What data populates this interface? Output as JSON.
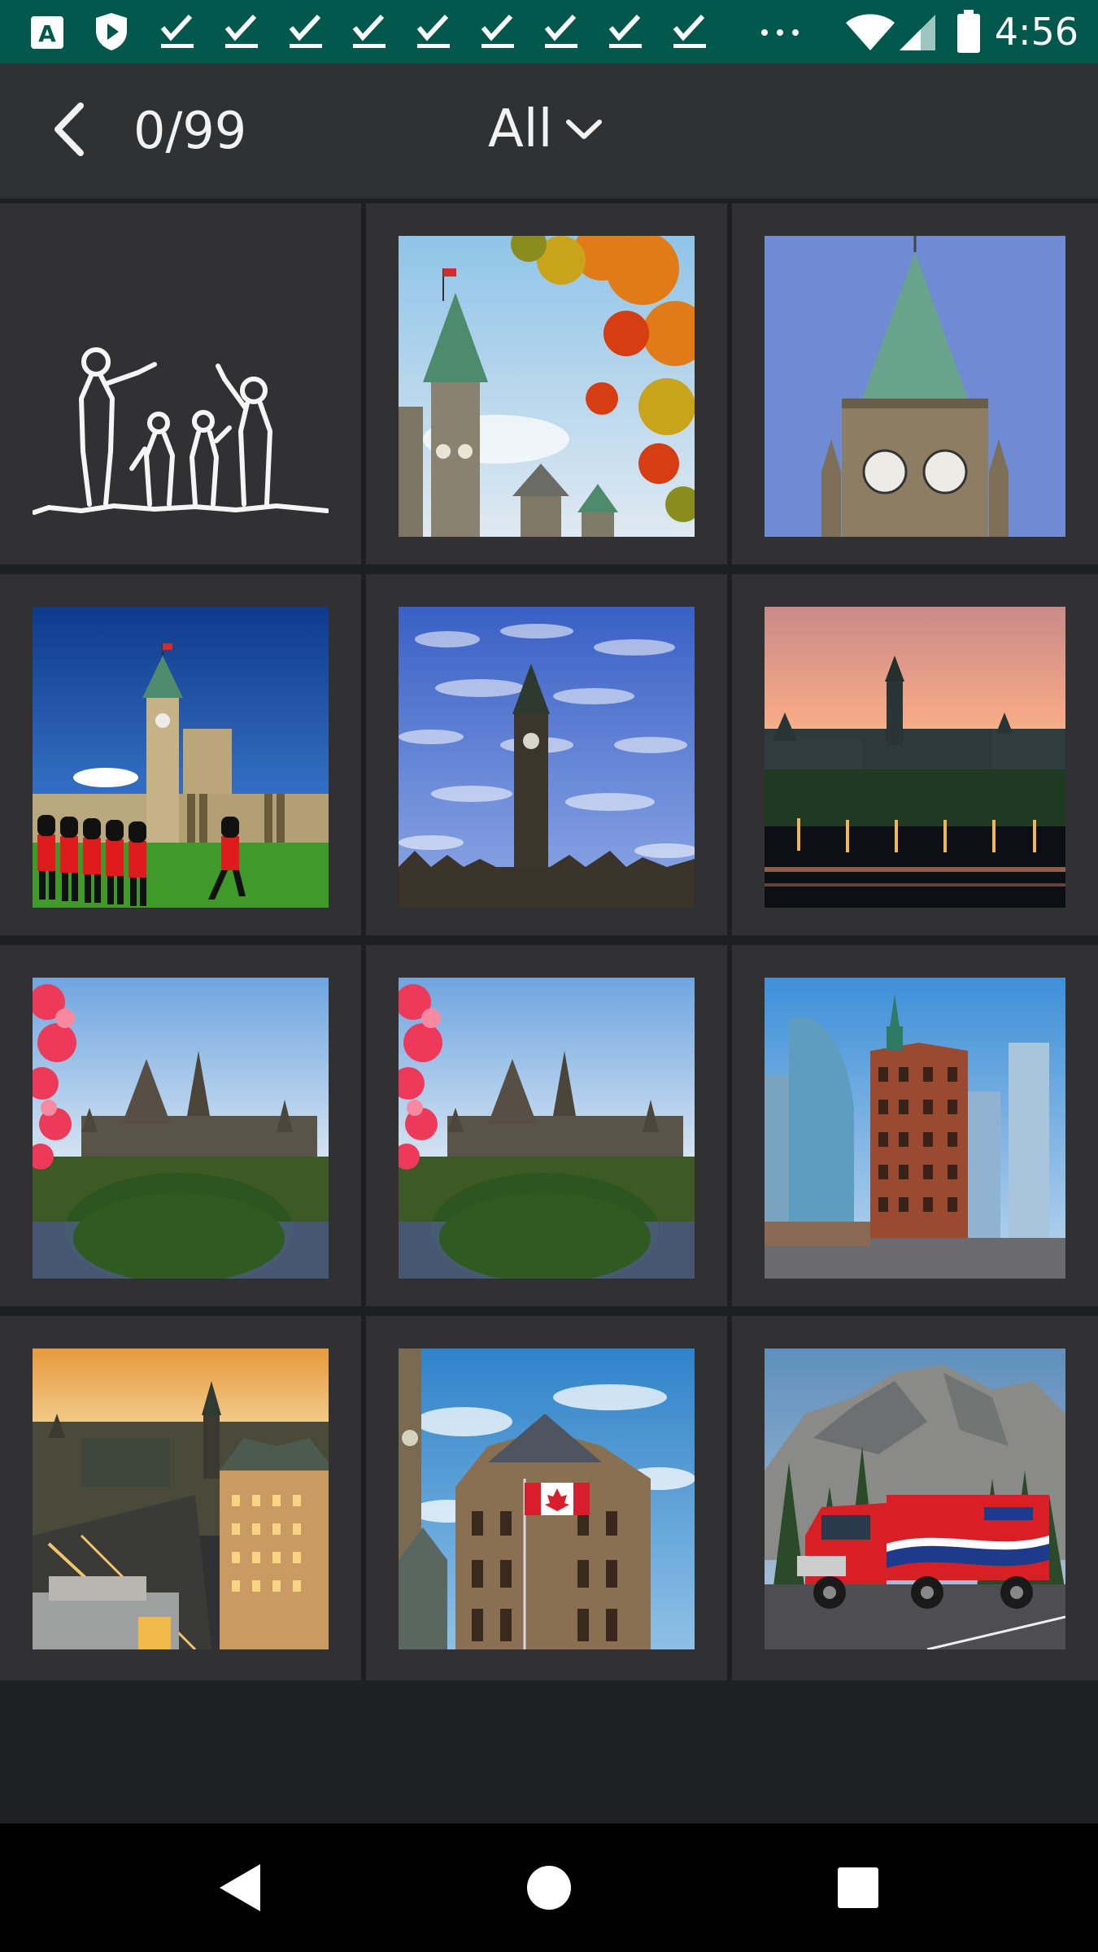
{
  "status_bar": {
    "time": "4:56",
    "icons": [
      "keyboard-a-icon",
      "shield-play-icon",
      "check-icon",
      "check-icon",
      "check-icon",
      "check-icon",
      "check-icon",
      "check-icon",
      "check-icon",
      "check-icon",
      "check-icon",
      "overflow-dots-icon",
      "wifi-icon",
      "cell-signal-icon",
      "battery-icon"
    ]
  },
  "top_bar": {
    "counter": "0/99",
    "filter_label": "All"
  },
  "gallery": {
    "thumbnails": [
      "family-silhouette-drawing",
      "peace-tower-autumn-leaves",
      "peace-tower-clock-closeup",
      "changing-guard-parliament",
      "tower-against-cloudy-sky",
      "parliament-sunset-river",
      "parliament-with-red-flowers",
      "parliament-with-red-flowers",
      "flatiron-building-toronto",
      "ottawa-evening-aerial",
      "old-city-hall-canada-flag",
      "canada-post-truck-mountains"
    ]
  },
  "colors": {
    "status_bar": "#00574b",
    "top_bar": "#303133",
    "grid_background": "#1e1f20",
    "cell": "#313133",
    "nav_bar": "#000000"
  },
  "nav_bar": {
    "buttons": [
      "back-triangle-icon",
      "home-circle-icon",
      "recents-square-icon"
    ]
  }
}
